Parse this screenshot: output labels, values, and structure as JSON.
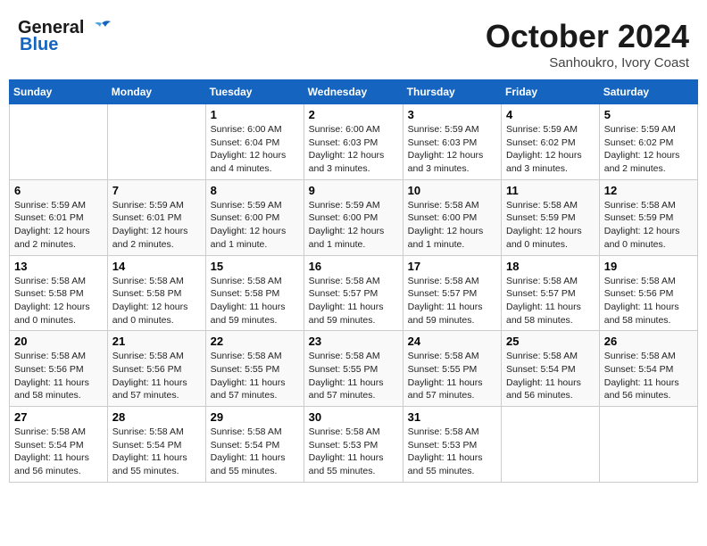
{
  "header": {
    "logo_general": "General",
    "logo_blue": "Blue",
    "month": "October 2024",
    "location": "Sanhoukro, Ivory Coast"
  },
  "days_of_week": [
    "Sunday",
    "Monday",
    "Tuesday",
    "Wednesday",
    "Thursday",
    "Friday",
    "Saturday"
  ],
  "weeks": [
    [
      {
        "day": "",
        "sunrise": "",
        "sunset": "",
        "daylight": ""
      },
      {
        "day": "",
        "sunrise": "",
        "sunset": "",
        "daylight": ""
      },
      {
        "day": "1",
        "sunrise": "Sunrise: 6:00 AM",
        "sunset": "Sunset: 6:04 PM",
        "daylight": "Daylight: 12 hours and 4 minutes."
      },
      {
        "day": "2",
        "sunrise": "Sunrise: 6:00 AM",
        "sunset": "Sunset: 6:03 PM",
        "daylight": "Daylight: 12 hours and 3 minutes."
      },
      {
        "day": "3",
        "sunrise": "Sunrise: 5:59 AM",
        "sunset": "Sunset: 6:03 PM",
        "daylight": "Daylight: 12 hours and 3 minutes."
      },
      {
        "day": "4",
        "sunrise": "Sunrise: 5:59 AM",
        "sunset": "Sunset: 6:02 PM",
        "daylight": "Daylight: 12 hours and 3 minutes."
      },
      {
        "day": "5",
        "sunrise": "Sunrise: 5:59 AM",
        "sunset": "Sunset: 6:02 PM",
        "daylight": "Daylight: 12 hours and 2 minutes."
      }
    ],
    [
      {
        "day": "6",
        "sunrise": "Sunrise: 5:59 AM",
        "sunset": "Sunset: 6:01 PM",
        "daylight": "Daylight: 12 hours and 2 minutes."
      },
      {
        "day": "7",
        "sunrise": "Sunrise: 5:59 AM",
        "sunset": "Sunset: 6:01 PM",
        "daylight": "Daylight: 12 hours and 2 minutes."
      },
      {
        "day": "8",
        "sunrise": "Sunrise: 5:59 AM",
        "sunset": "Sunset: 6:00 PM",
        "daylight": "Daylight: 12 hours and 1 minute."
      },
      {
        "day": "9",
        "sunrise": "Sunrise: 5:59 AM",
        "sunset": "Sunset: 6:00 PM",
        "daylight": "Daylight: 12 hours and 1 minute."
      },
      {
        "day": "10",
        "sunrise": "Sunrise: 5:58 AM",
        "sunset": "Sunset: 6:00 PM",
        "daylight": "Daylight: 12 hours and 1 minute."
      },
      {
        "day": "11",
        "sunrise": "Sunrise: 5:58 AM",
        "sunset": "Sunset: 5:59 PM",
        "daylight": "Daylight: 12 hours and 0 minutes."
      },
      {
        "day": "12",
        "sunrise": "Sunrise: 5:58 AM",
        "sunset": "Sunset: 5:59 PM",
        "daylight": "Daylight: 12 hours and 0 minutes."
      }
    ],
    [
      {
        "day": "13",
        "sunrise": "Sunrise: 5:58 AM",
        "sunset": "Sunset: 5:58 PM",
        "daylight": "Daylight: 12 hours and 0 minutes."
      },
      {
        "day": "14",
        "sunrise": "Sunrise: 5:58 AM",
        "sunset": "Sunset: 5:58 PM",
        "daylight": "Daylight: 12 hours and 0 minutes."
      },
      {
        "day": "15",
        "sunrise": "Sunrise: 5:58 AM",
        "sunset": "Sunset: 5:58 PM",
        "daylight": "Daylight: 11 hours and 59 minutes."
      },
      {
        "day": "16",
        "sunrise": "Sunrise: 5:58 AM",
        "sunset": "Sunset: 5:57 PM",
        "daylight": "Daylight: 11 hours and 59 minutes."
      },
      {
        "day": "17",
        "sunrise": "Sunrise: 5:58 AM",
        "sunset": "Sunset: 5:57 PM",
        "daylight": "Daylight: 11 hours and 59 minutes."
      },
      {
        "day": "18",
        "sunrise": "Sunrise: 5:58 AM",
        "sunset": "Sunset: 5:57 PM",
        "daylight": "Daylight: 11 hours and 58 minutes."
      },
      {
        "day": "19",
        "sunrise": "Sunrise: 5:58 AM",
        "sunset": "Sunset: 5:56 PM",
        "daylight": "Daylight: 11 hours and 58 minutes."
      }
    ],
    [
      {
        "day": "20",
        "sunrise": "Sunrise: 5:58 AM",
        "sunset": "Sunset: 5:56 PM",
        "daylight": "Daylight: 11 hours and 58 minutes."
      },
      {
        "day": "21",
        "sunrise": "Sunrise: 5:58 AM",
        "sunset": "Sunset: 5:56 PM",
        "daylight": "Daylight: 11 hours and 57 minutes."
      },
      {
        "day": "22",
        "sunrise": "Sunrise: 5:58 AM",
        "sunset": "Sunset: 5:55 PM",
        "daylight": "Daylight: 11 hours and 57 minutes."
      },
      {
        "day": "23",
        "sunrise": "Sunrise: 5:58 AM",
        "sunset": "Sunset: 5:55 PM",
        "daylight": "Daylight: 11 hours and 57 minutes."
      },
      {
        "day": "24",
        "sunrise": "Sunrise: 5:58 AM",
        "sunset": "Sunset: 5:55 PM",
        "daylight": "Daylight: 11 hours and 57 minutes."
      },
      {
        "day": "25",
        "sunrise": "Sunrise: 5:58 AM",
        "sunset": "Sunset: 5:54 PM",
        "daylight": "Daylight: 11 hours and 56 minutes."
      },
      {
        "day": "26",
        "sunrise": "Sunrise: 5:58 AM",
        "sunset": "Sunset: 5:54 PM",
        "daylight": "Daylight: 11 hours and 56 minutes."
      }
    ],
    [
      {
        "day": "27",
        "sunrise": "Sunrise: 5:58 AM",
        "sunset": "Sunset: 5:54 PM",
        "daylight": "Daylight: 11 hours and 56 minutes."
      },
      {
        "day": "28",
        "sunrise": "Sunrise: 5:58 AM",
        "sunset": "Sunset: 5:54 PM",
        "daylight": "Daylight: 11 hours and 55 minutes."
      },
      {
        "day": "29",
        "sunrise": "Sunrise: 5:58 AM",
        "sunset": "Sunset: 5:54 PM",
        "daylight": "Daylight: 11 hours and 55 minutes."
      },
      {
        "day": "30",
        "sunrise": "Sunrise: 5:58 AM",
        "sunset": "Sunset: 5:53 PM",
        "daylight": "Daylight: 11 hours and 55 minutes."
      },
      {
        "day": "31",
        "sunrise": "Sunrise: 5:58 AM",
        "sunset": "Sunset: 5:53 PM",
        "daylight": "Daylight: 11 hours and 55 minutes."
      },
      {
        "day": "",
        "sunrise": "",
        "sunset": "",
        "daylight": ""
      },
      {
        "day": "",
        "sunrise": "",
        "sunset": "",
        "daylight": ""
      }
    ]
  ]
}
